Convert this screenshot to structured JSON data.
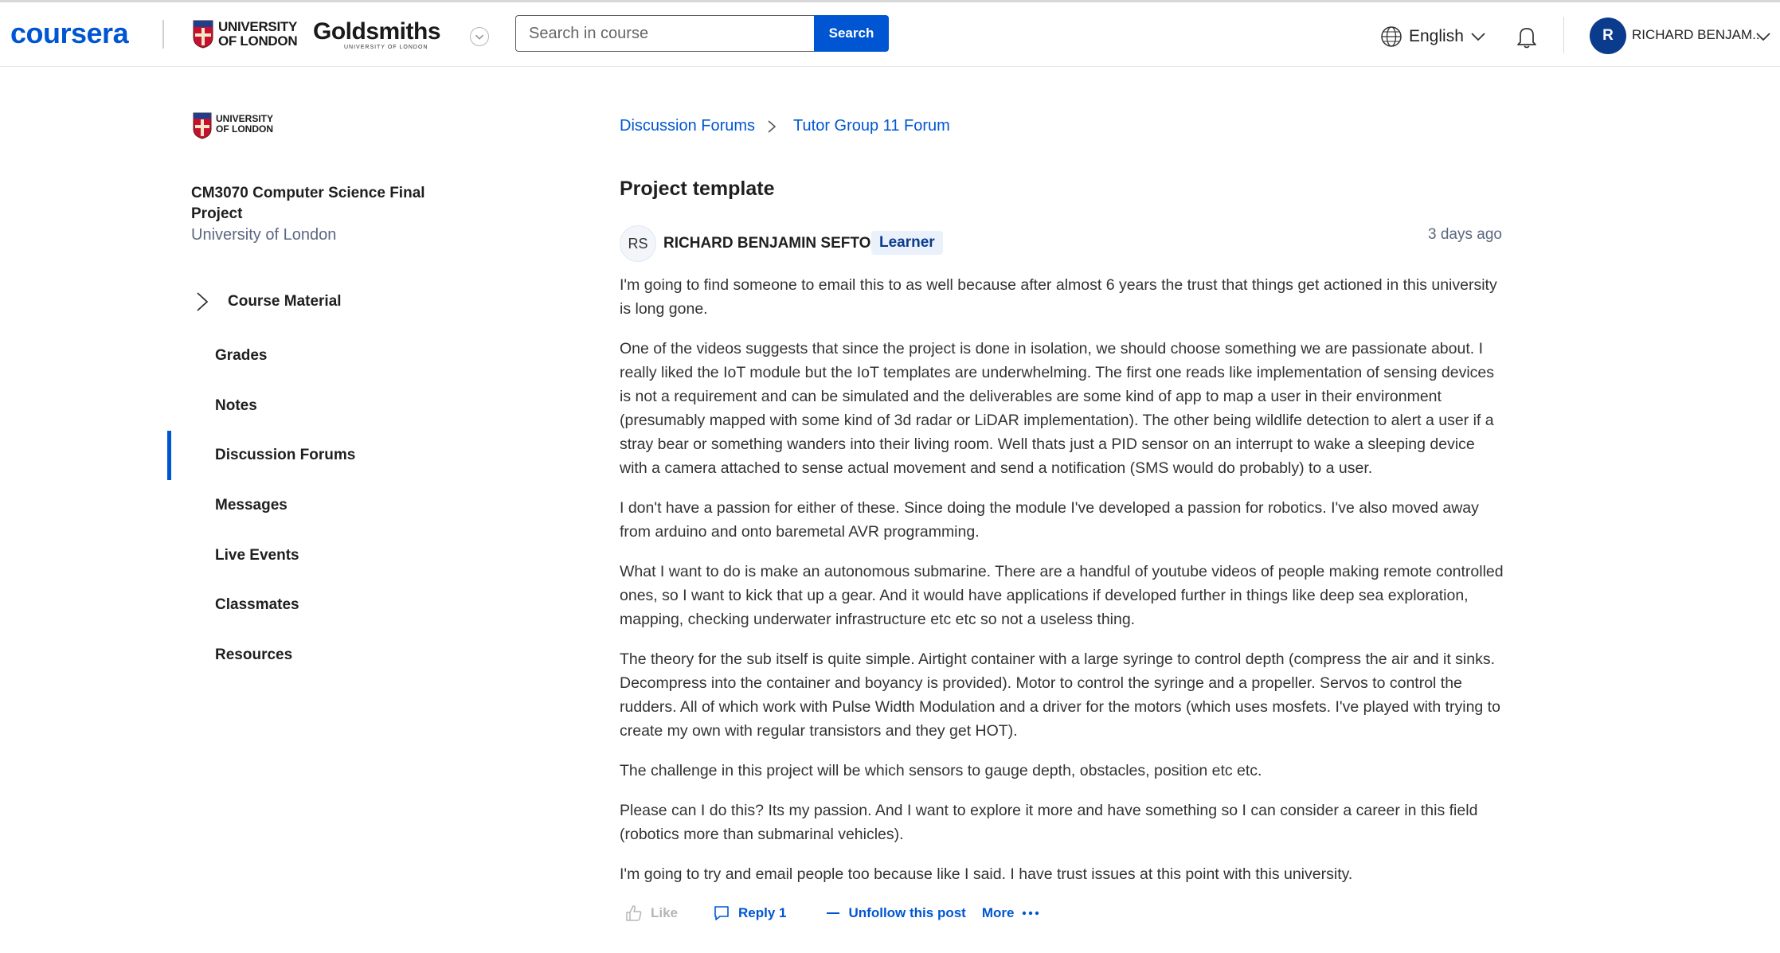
{
  "header": {
    "brand": "coursera",
    "partner1": [
      "UNIVERSITY",
      "OF LONDON"
    ],
    "partner2": "Goldsmiths",
    "partner2_sub": "UNIVERSITY OF LONDON",
    "search_placeholder": "Search in course",
    "search_button": "Search",
    "language": "English",
    "user_initial": "R",
    "user_name": "RICHARD BENJAM...",
    "colors": {
      "brand": "#0056d2",
      "avatar": "#0b3b8c"
    }
  },
  "sidebar": {
    "institution": [
      "UNIVERSITY",
      "OF LONDON"
    ],
    "course_title": "CM3070 Computer Science Final Project",
    "course_org": "University of London",
    "course_material": "Course Material",
    "items": [
      {
        "label": "Grades"
      },
      {
        "label": "Notes"
      },
      {
        "label": "Discussion Forums"
      },
      {
        "label": "Messages"
      },
      {
        "label": "Live Events"
      },
      {
        "label": "Classmates"
      },
      {
        "label": "Resources"
      }
    ],
    "active": "Discussion Forums"
  },
  "main": {
    "breadcrumb": [
      "Discussion Forums",
      "Tutor Group 11 Forum"
    ],
    "title": "Project template",
    "post": {
      "author_initials": "RS",
      "author_name": "RICHARD BENJAMIN SEFTON",
      "role": "Learner",
      "date": "3 days ago",
      "paragraphs": [
        "I'm going to find someone to email this to as well because after almost 6 years the trust that things get actioned in this university is long gone.",
        "One of the videos suggests that since the project is done in isolation, we should choose something we are passionate about. I really liked the IoT module but the IoT templates are underwhelming. The first one reads like implementation of sensing devices is not a requirement and can be simulated and the deliverables are some kind of app to map a user in their environment (presumably mapped with some kind of 3d radar or LiDAR implementation). The other being wildlife detection to alert a user if a stray bear or something wanders into their living room. Well thats just a PID sensor on an interrupt to wake a sleeping device with a camera attached to sense actual movement and send a notification (SMS would do probably) to a user.",
        "I don't have a passion for either of these. Since doing the module I've developed a passion for robotics. I've also moved away from arduino and onto baremetal AVR programming.",
        "What I want to do is make an autonomous submarine. There are a handful of youtube videos of people making remote controlled ones, so I want to kick that up a gear. And it would have applications if developed further in things like deep sea exploration, mapping, checking underwater infrastructure etc etc so not a useless thing.",
        "The theory for the sub itself is quite simple. Airtight container with a large syringe to control depth (compress the air and it sinks. Decompress into the container and boyancy is provided). Motor to control the syringe and a propeller. Servos to control the rudders. All of which work with Pulse Width Modulation and a driver for the motors (which uses mosfets. I've played with trying to create my own with regular transistors and they get HOT).",
        "The challenge in this project will be which sensors to gauge depth, obstacles, position etc etc.",
        "Please can I do this? Its my passion. And I want to explore it more and have something so I can consider a career in this field (robotics more than submarinal vehicles).",
        "I'm going to try and email people too because like I said. I have trust issues at this point with this university."
      ],
      "actions": {
        "like": "Like",
        "reply": "Reply 1",
        "unfollow": "Unfollow this post",
        "more": "More"
      }
    }
  }
}
